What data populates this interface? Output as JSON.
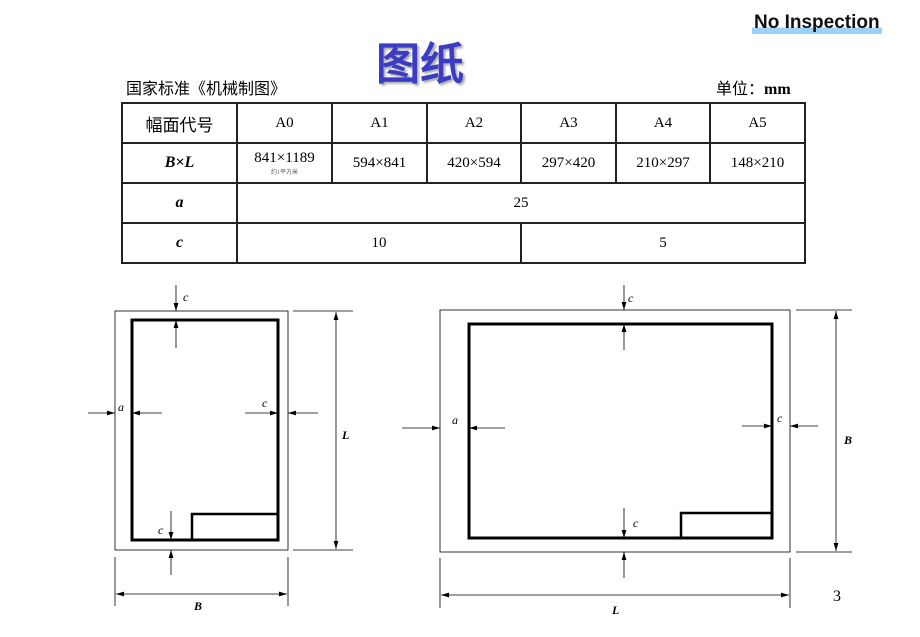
{
  "title": "图纸",
  "stamp": "No Inspection",
  "standard": "国家标准《机械制图》",
  "unit_label": "单位：",
  "unit_value": "mm",
  "table": {
    "header": [
      "幅面代号",
      "A0",
      "A1",
      "A2",
      "A3",
      "A4",
      "A5"
    ],
    "bl_label": "B×L",
    "bl_values": [
      "841×1189",
      "594×841",
      "420×594",
      "297×420",
      "210×297",
      "148×210"
    ],
    "a0_note": "约1平方米",
    "a_label": "a",
    "a_value": "25",
    "c_label": "c",
    "c_values": [
      "10",
      "5"
    ]
  },
  "diagram_labels": {
    "a": "a",
    "c": "c",
    "L": "L",
    "B": "B"
  },
  "page_number": "3"
}
